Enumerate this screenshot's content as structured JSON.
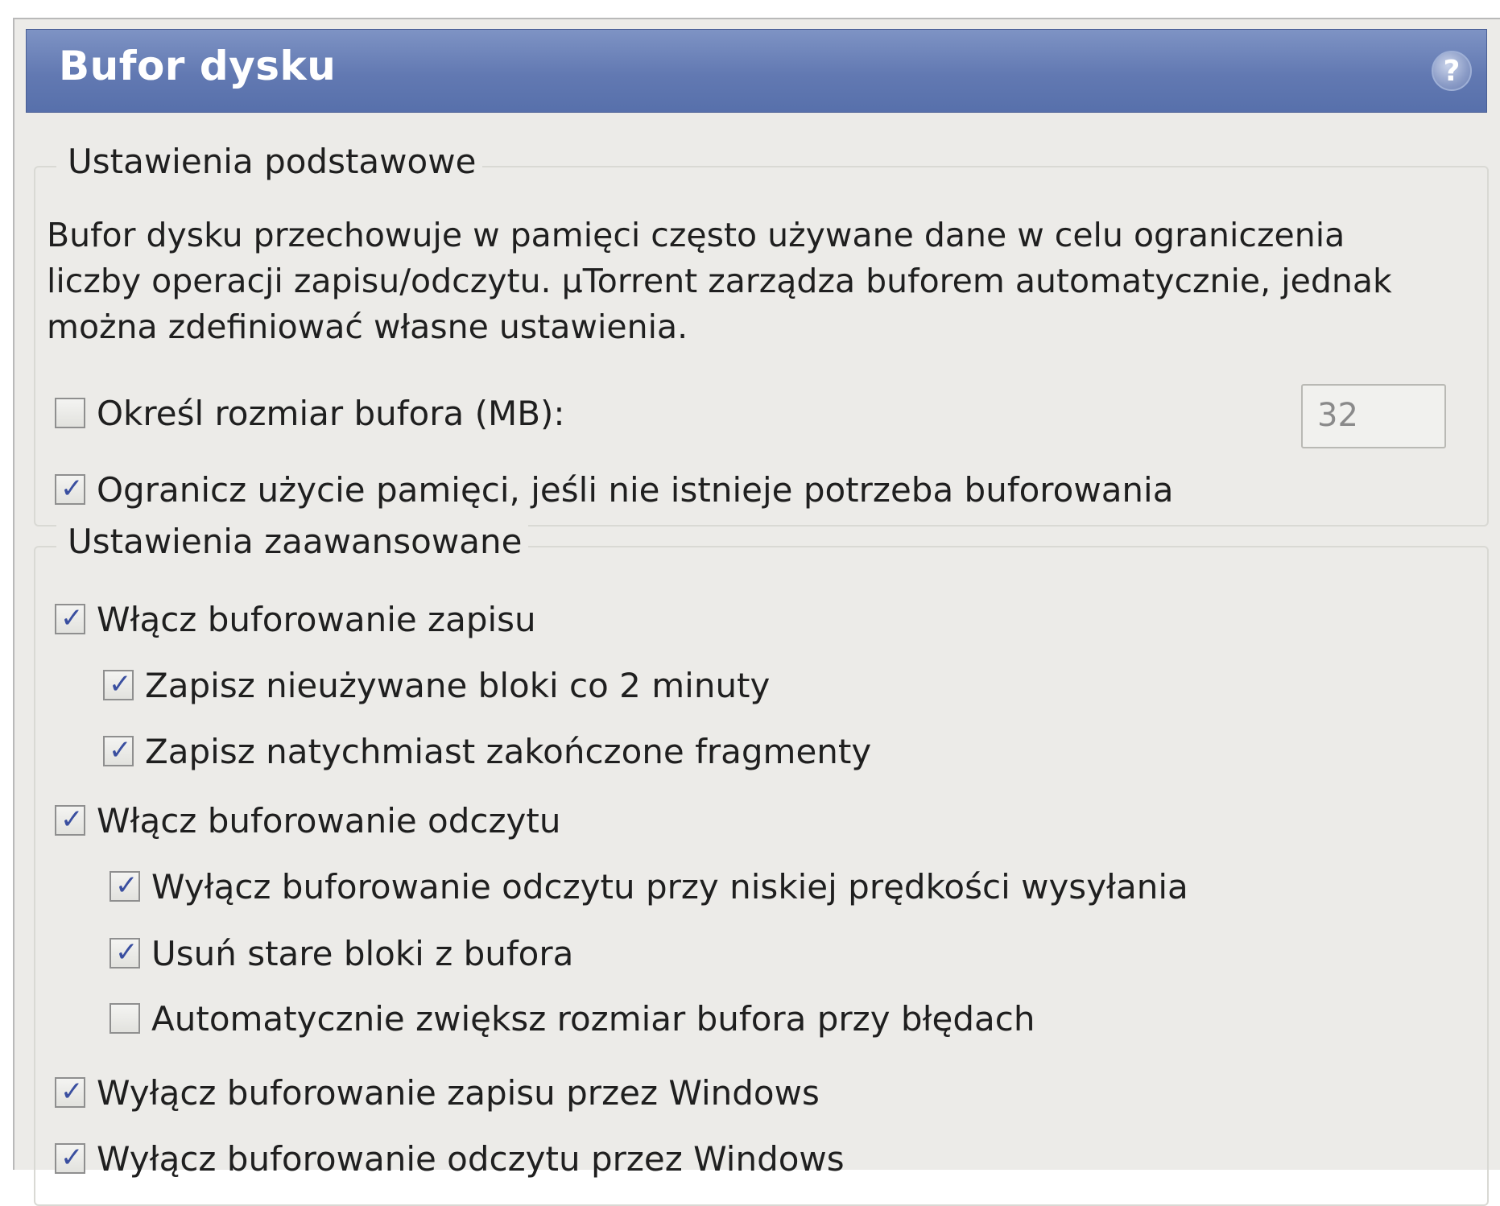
{
  "header": {
    "title": "Bufor dysku",
    "help_icon": "help-icon"
  },
  "basic": {
    "legend": "Ustawienia podstawowe",
    "description": "Bufor dysku przechowuje w pamięci często używane dane w celu ograniczenia liczby operacji zapisu/odczytu. µTorrent zarządza buforem automatycznie, jednak można zdefiniować własne ustawienia.",
    "specify_size": {
      "label": "Określ rozmiar bufora (MB):",
      "checked": false,
      "value": "32"
    },
    "limit_memory": {
      "label": "Ogranicz użycie pamięci, jeśli nie istnieje potrzeba buforowania",
      "checked": true
    }
  },
  "advanced": {
    "legend": "Ustawienia zaawansowane",
    "items": [
      {
        "label": "Włącz buforowanie zapisu",
        "checked": true
      },
      {
        "label": "Zapisz nieużywane bloki co 2 minuty",
        "checked": true
      },
      {
        "label": "Zapisz natychmiast zakończone fragmenty",
        "checked": true
      },
      {
        "label": "Włącz buforowanie odczytu",
        "checked": true
      },
      {
        "label": "Wyłącz buforowanie odczytu przy niskiej prędkości wysyłania",
        "checked": true
      },
      {
        "label": "Usuń stare bloki z bufora",
        "checked": true
      },
      {
        "label": "Automatycznie zwiększ rozmiar bufora przy błędach",
        "checked": false
      },
      {
        "label": "Wyłącz buforowanie zapisu przez Windows",
        "checked": true
      },
      {
        "label": "Wyłącz buforowanie odczytu przez Windows",
        "checked": true
      }
    ]
  }
}
